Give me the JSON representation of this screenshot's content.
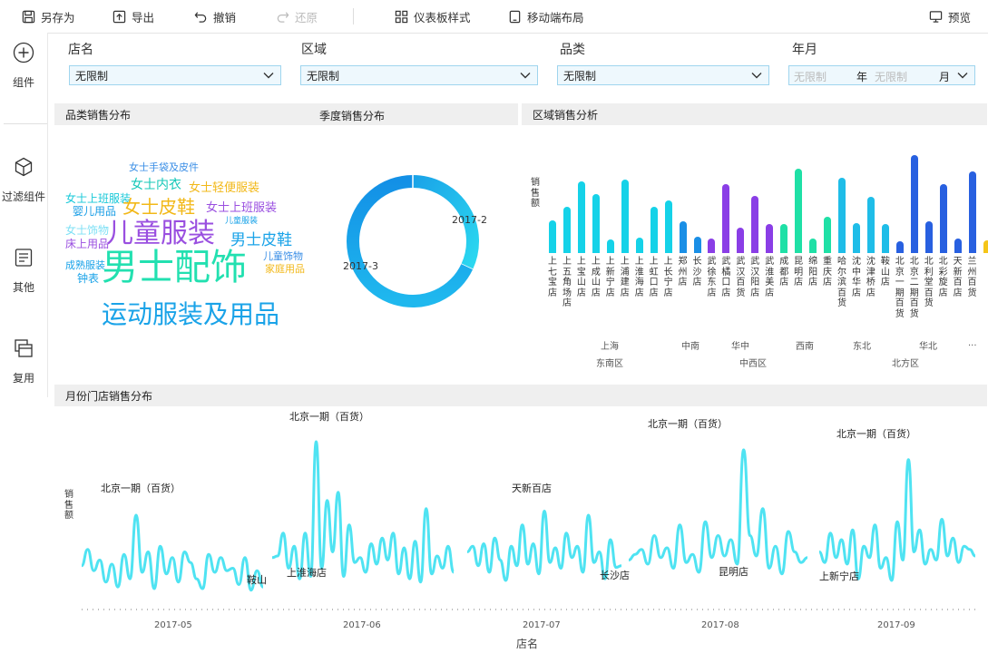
{
  "toolbar": {
    "save_as": "另存为",
    "export": "导出",
    "undo": "撤销",
    "redo": "还原",
    "dashboard_style": "仪表板样式",
    "mobile_layout": "移动端布局",
    "preview": "预览"
  },
  "sidebar": {
    "items": [
      {
        "label": "组件",
        "icon": "plus-circle-icon"
      },
      {
        "label": "过滤组件",
        "icon": "cube-icon"
      },
      {
        "label": "其他",
        "icon": "document-icon"
      },
      {
        "label": "复用",
        "icon": "layers-icon"
      }
    ]
  },
  "filters": {
    "store": {
      "label": "店名",
      "value": "无限制"
    },
    "region": {
      "label": "区域",
      "value": "无限制"
    },
    "category": {
      "label": "品类",
      "value": "无限制"
    },
    "month": {
      "label": "年月",
      "year_placeholder": "无限制",
      "year_unit": "年",
      "month_placeholder": "无限制",
      "month_unit": "月"
    }
  },
  "colors": {
    "accent": "#1aa3e8",
    "line": "#4fe3f2",
    "panel_header": "#efefef"
  },
  "panels": {
    "category": {
      "title": "品类销售分布"
    },
    "quarter": {
      "title": "季度销售分布"
    },
    "region": {
      "title": "区域销售分析"
    },
    "monthly": {
      "title": "月份门店销售分布"
    }
  },
  "chart_data": [
    {
      "type": "wordcloud",
      "words": [
        {
          "text": "女士手袋及皮件",
          "color": "#3a8ee6"
        },
        {
          "text": "女士内衣",
          "color": "#16c8b8"
        },
        {
          "text": "女士轻便服装",
          "color": "#f2b818"
        },
        {
          "text": "女士上班服装",
          "color": "#16c8d8"
        },
        {
          "text": "婴儿用品",
          "color": "#1a9ee6"
        },
        {
          "text": "女士皮鞋",
          "color": "#f2b818"
        },
        {
          "text": "女士上班服装",
          "color": "#9a4fe0"
        },
        {
          "text": "儿童服装",
          "color": "#1aa3e8"
        },
        {
          "text": "女士饰物",
          "color": "#7ee0f5"
        },
        {
          "text": "儿童服装",
          "color": "#9a4fe0"
        },
        {
          "text": "男士皮鞋",
          "color": "#1aa3e8"
        },
        {
          "text": "床上用品",
          "color": "#9a4fe0"
        },
        {
          "text": "儿童饰物",
          "color": "#3a8ee6"
        },
        {
          "text": "成熟服装",
          "color": "#1aa3e8"
        },
        {
          "text": "男士配饰",
          "color": "#22e0b0"
        },
        {
          "text": "家庭用品",
          "color": "#f2b818"
        },
        {
          "text": "钟表",
          "color": "#1aa3e8"
        },
        {
          "text": "运动服装及用品",
          "color": "#1aa3e8"
        }
      ]
    },
    {
      "type": "pie",
      "slices": [
        {
          "name": "2017-2",
          "value": 32
        },
        {
          "name": "2017-3",
          "value": 68
        }
      ]
    },
    {
      "type": "bar",
      "ylabel": "销售额",
      "categories": [
        "上七宝店",
        "上五角场店",
        "上宝山店",
        "上成山店",
        "上新宁店",
        "上浦建店",
        "上淮海店",
        "上虹口店",
        "上长宁店",
        "郑州店",
        "长沙店",
        "武徐东店",
        "武橘口店",
        "武汉百货",
        "武汉阳店",
        "武淮美店",
        "成都店",
        "昆明店",
        "绵阳店",
        "重庆店",
        "哈尔滨百货",
        "沈中华店",
        "沈津桥店",
        "鞍山店",
        "北京一期百货",
        "北京二期百货",
        "北利堂百货",
        "北彩旋店",
        "天新百店",
        "兰州百货"
      ],
      "values": [
        33,
        47,
        73,
        60,
        14,
        75,
        16,
        47,
        54,
        32,
        17,
        15,
        70,
        26,
        58,
        30,
        30,
        86,
        15,
        37,
        77,
        31,
        57,
        30,
        12,
        100,
        32,
        70,
        15,
        83,
        13
      ],
      "region_labels": [
        "上海",
        "中南",
        "华中",
        "西南",
        "东北",
        "华北",
        "..."
      ],
      "area_labels": [
        "东南区",
        "中西区",
        "北方区"
      ]
    },
    {
      "type": "line",
      "ylabel": "销售额",
      "xlabel": "店名",
      "x_ticks": [
        "2017-05",
        "2017-06",
        "2017-07",
        "2017-08",
        "2017-09"
      ],
      "annotations": [
        "北京一期（百货）",
        "鞍山",
        "北京一期（百货）",
        "上淮海店",
        "天新百店",
        "长沙店",
        "北京一期（百货）",
        "昆明店",
        "北京一期（百货）",
        "上新宁店"
      ],
      "series": [
        {
          "values": [
            38,
            58,
            32,
            45,
            18,
            40,
            12,
            52,
            22,
            100,
            30,
            55,
            10,
            62,
            28,
            48,
            18,
            55,
            42,
            22,
            10,
            52,
            30,
            48,
            32,
            35,
            15,
            48,
            8,
            32,
            12
          ]
        },
        {
          "values": [
            48,
            50,
            78,
            35,
            62,
            22,
            78,
            25,
            190,
            35,
            118,
            55,
            128,
            25,
            88,
            42,
            48,
            30,
            65,
            40,
            72,
            45,
            78,
            28,
            60,
            22,
            68,
            18,
            108,
            28,
            50,
            35,
            62,
            30
          ]
        },
        {
          "values": [
            55,
            62,
            38,
            65,
            30,
            72,
            45,
            20,
            62,
            38,
            88,
            40,
            65,
            28,
            105,
            42,
            60,
            35,
            78,
            48,
            62,
            30,
            100,
            42,
            55,
            22,
            70,
            36,
            38
          ]
        },
        {
          "values": [
            45,
            52,
            58,
            40,
            75,
            48,
            60,
            35,
            88,
            42,
            52,
            30,
            92,
            48,
            75,
            50,
            70,
            40,
            180,
            75,
            50,
            108,
            35,
            62,
            28,
            80,
            55,
            42,
            48
          ]
        },
        {
          "values": [
            55,
            42,
            78,
            48,
            70,
            40,
            82,
            22,
            62,
            48,
            88,
            35,
            48,
            20,
            92,
            45,
            168,
            55,
            82,
            40,
            58,
            45,
            95,
            50,
            72,
            42,
            62,
            58,
            50
          ]
        }
      ]
    }
  ]
}
